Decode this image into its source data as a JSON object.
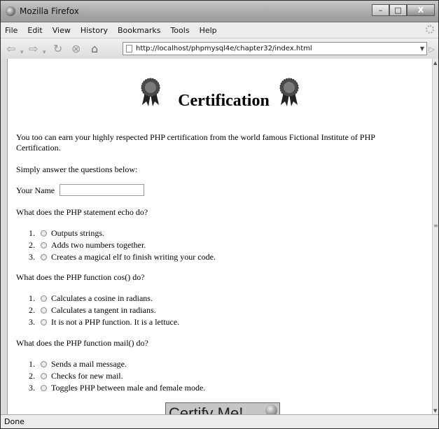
{
  "window": {
    "title": "Mozilla Firefox",
    "minimize": "–",
    "maximize": "□",
    "close": "X"
  },
  "menu": [
    {
      "label": "File"
    },
    {
      "label": "Edit"
    },
    {
      "label": "View"
    },
    {
      "label": "History"
    },
    {
      "label": "Bookmarks"
    },
    {
      "label": "Tools"
    },
    {
      "label": "Help"
    }
  ],
  "nav": {
    "url": "http://localhost/phpmysql4e/chapter32/index.html"
  },
  "page": {
    "heading": "Certification",
    "intro": "You too can earn your highly respected PHP certification from the world famous Fictional Institute of PHP Certification.",
    "instructions": "Simply answer the questions below:",
    "name_label": "Your Name",
    "name_value": "",
    "questions": [
      {
        "text": "What does the PHP statement echo do?",
        "options": [
          {
            "num": "1.",
            "label": "Outputs strings."
          },
          {
            "num": "2.",
            "label": "Adds two numbers together."
          },
          {
            "num": "3.",
            "label": "Creates a magical elf to finish writing your code."
          }
        ]
      },
      {
        "text": "What does the PHP function cos() do?",
        "options": [
          {
            "num": "1.",
            "label": "Calculates a cosine in radians."
          },
          {
            "num": "2.",
            "label": "Calculates a tangent in radians."
          },
          {
            "num": "3.",
            "label": "It is not a PHP function. It is a lettuce."
          }
        ]
      },
      {
        "text": "What does the PHP function mail() do?",
        "options": [
          {
            "num": "1.",
            "label": "Sends a mail message."
          },
          {
            "num": "2.",
            "label": "Checks for new mail."
          },
          {
            "num": "3.",
            "label": "Toggles PHP between male and female mode."
          }
        ]
      }
    ],
    "submit_label": "Certify Me!"
  },
  "status": "Done"
}
